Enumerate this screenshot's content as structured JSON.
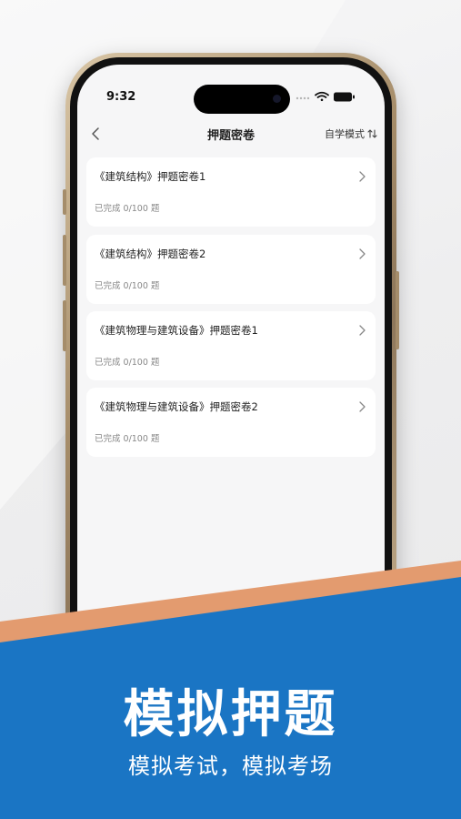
{
  "status_bar": {
    "time": "9:32"
  },
  "nav": {
    "title": "押题密卷",
    "mode_label": "自学模式"
  },
  "papers": [
    {
      "title": "《建筑结构》押题密卷1",
      "progress": "已完成  0/100 题"
    },
    {
      "title": "《建筑结构》押题密卷2",
      "progress": "已完成  0/100 题"
    },
    {
      "title": "《建筑物理与建筑设备》押题密卷1",
      "progress": "已完成  0/100 题"
    },
    {
      "title": "《建筑物理与建筑设备》押题密卷2",
      "progress": "已完成  0/100 题"
    }
  ],
  "promo": {
    "headline": "模拟押题",
    "subline": "模拟考试，模拟考场"
  },
  "colors": {
    "banner_blue": "#1a75c4",
    "banner_accent": "#e39b6f",
    "card_bg": "#ffffff"
  }
}
